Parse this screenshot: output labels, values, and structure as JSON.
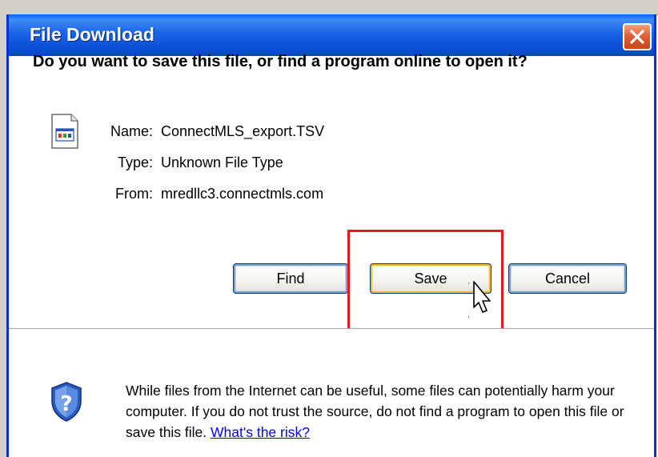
{
  "dialog": {
    "title": "File Download",
    "question": "Do you want to save this file, or find a program online to open it?"
  },
  "file_info": {
    "name_label": "Name:",
    "name_value": "ConnectMLS_export.TSV",
    "type_label": "Type:",
    "type_value": "Unknown File Type",
    "from_label": "From:",
    "from_value": "mredllc3.connectmls.com"
  },
  "buttons": {
    "find": "Find",
    "save": "Save",
    "cancel": "Cancel"
  },
  "warning": {
    "text": "While files from the Internet can be useful, some files can potentially harm your computer. If you do not trust the source, do not find a program to open this file or save this file.",
    "link": "What's the risk?"
  },
  "icons": {
    "file": "unknown-file-icon",
    "shield": "security-shield-icon",
    "close": "close-icon",
    "cursor": "mouse-pointer-icon"
  },
  "colors": {
    "titlebar": "#0a5ee8",
    "highlight": "#e0182a",
    "link": "#0000ee"
  }
}
